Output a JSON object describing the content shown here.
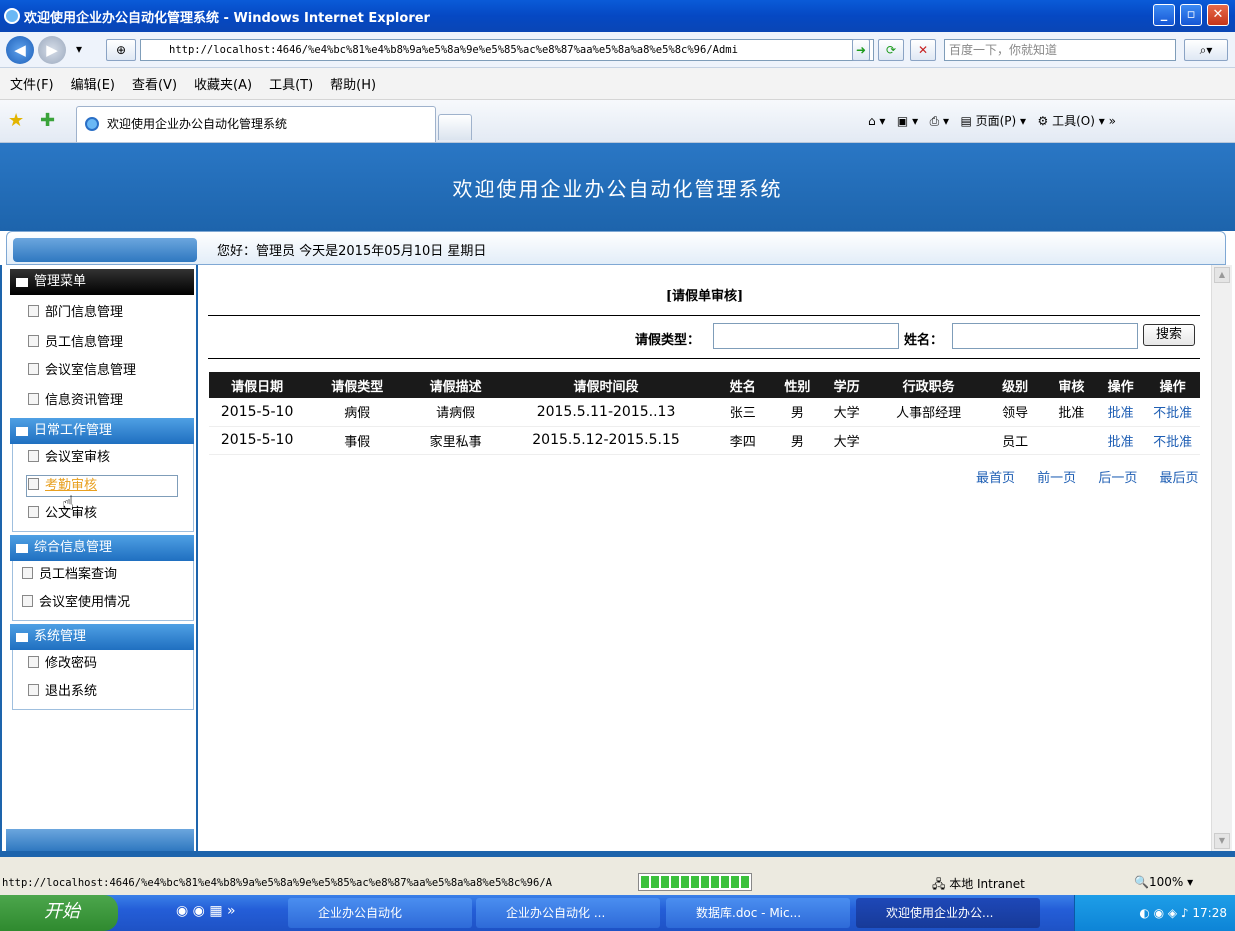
{
  "window": {
    "title": "欢迎使用企业办公自动化管理系统 - Windows Internet Explorer"
  },
  "address": {
    "url": "http://localhost:4646/%e4%bc%81%e4%b8%9a%e5%8a%9e%e5%85%ac%e8%87%aa%e5%8a%a8%e5%8c%96/Admi",
    "search_placeholder": "百度一下，你就知道"
  },
  "menubar": [
    "文件(F)",
    "编辑(E)",
    "查看(V)",
    "收藏夹(A)",
    "工具(T)",
    "帮助(H)"
  ],
  "tab": {
    "title": "欢迎使用企业办公自动化管理系统"
  },
  "commandbar": {
    "page": "页面(P)",
    "tools": "工具(O)"
  },
  "banner": {
    "title": "欢迎使用企业办公自动化管理系统"
  },
  "welcome": {
    "text": "您好：管理员   今天是2015年05月10日   星期日"
  },
  "sidebar": {
    "header": "管理菜单",
    "items1": [
      "部门信息管理",
      "员工信息管理",
      "会议室信息管理",
      "信息资讯管理"
    ],
    "section2": "日常工作管理",
    "items2": [
      "会议室审核",
      "考勤审核",
      "公文审核"
    ],
    "section3": "综合信息管理",
    "items3": [
      "员工档案查询",
      "会议室使用情况"
    ],
    "section4": "系统管理",
    "items4": [
      "修改密码",
      "退出系统"
    ]
  },
  "main": {
    "title": "[请假单审核]",
    "filter_type_label": "请假类型：",
    "filter_name_label": "姓名：",
    "search_button": "搜索",
    "columns": [
      "请假日期",
      "请假类型",
      "请假描述",
      "请假时间段",
      "姓名",
      "性别",
      "学历",
      "行政职务",
      "级别",
      "审核",
      "操作",
      "操作"
    ],
    "rows": [
      {
        "date": "2015-5-10",
        "type": "病假",
        "desc": "请病假",
        "period": "2015.5.11-2015..13",
        "name": "张三",
        "sex": "男",
        "edu": "大学",
        "duty": "人事部经理",
        "level": "领导",
        "audit": "批准",
        "op1": "批准",
        "op2": "不批准"
      },
      {
        "date": "2015-5-10",
        "type": "事假",
        "desc": "家里私事",
        "period": "2015.5.12-2015.5.15",
        "name": "李四",
        "sex": "男",
        "edu": "大学",
        "duty": "",
        "level": "员工",
        "audit": "",
        "op1": "批准",
        "op2": "不批准"
      }
    ],
    "pager": [
      "最首页",
      "前一页",
      "后一页",
      "最后页"
    ]
  },
  "status": {
    "url": "http://localhost:4646/%e4%bc%81%e4%b8%9a%e5%8a%9e%e5%85%ac%e8%87%aa%e5%8a%a8%e5%8c%96/A",
    "zone": "本地 Intranet",
    "zoom": "100%"
  },
  "taskbar": {
    "start": "开始",
    "tasks": [
      "企业办公自动化",
      "企业办公自动化 ...",
      "数据库.doc - Mic...",
      "欢迎使用企业办公..."
    ],
    "clock": "17:28"
  }
}
